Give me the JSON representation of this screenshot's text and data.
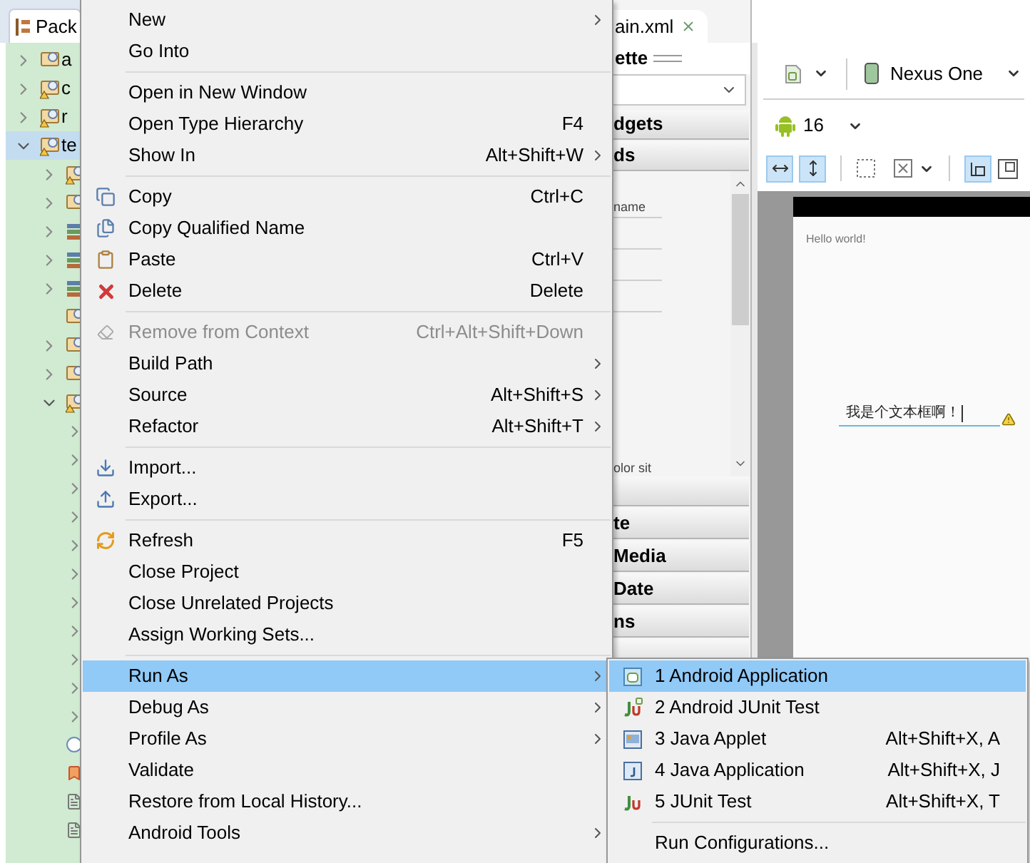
{
  "explorer": {
    "tab_label": "Pack",
    "items": [
      {
        "label": "a",
        "kind": "project",
        "expanded": false,
        "selected": false
      },
      {
        "label": "c",
        "kind": "project-warning",
        "expanded": false,
        "selected": false
      },
      {
        "label": "r",
        "kind": "project-warning",
        "expanded": false,
        "selected": false
      },
      {
        "label": "te",
        "kind": "project-warning",
        "expanded": true,
        "selected": true,
        "children": [
          {
            "kind": "package-warning",
            "expanded": false
          },
          {
            "kind": "package",
            "expanded": false
          },
          {
            "kind": "library",
            "expanded": false
          },
          {
            "kind": "library",
            "expanded": false
          },
          {
            "kind": "library",
            "expanded": false
          },
          {
            "kind": "package"
          },
          {
            "kind": "package",
            "expanded": false
          },
          {
            "kind": "package",
            "expanded": false
          },
          {
            "kind": "package-warning",
            "expanded": true,
            "children": [
              {
                "expanded": false
              },
              {
                "expanded": false
              },
              {
                "expanded": false
              },
              {
                "expanded": false
              },
              {
                "expanded": false
              },
              {
                "expanded": false
              },
              {
                "expanded": false
              },
              {
                "expanded": false
              },
              {
                "expanded": false
              },
              {
                "expanded": false
              },
              {
                "expanded": false
              }
            ]
          },
          {
            "kind": "class"
          },
          {
            "kind": "bookmark"
          },
          {
            "kind": "file"
          },
          {
            "kind": "file"
          }
        ]
      }
    ]
  },
  "palette": {
    "editor_tab": "ain.xml",
    "title": "ette",
    "sections_top": [
      {
        "label": "dgets"
      },
      {
        "label": "ds"
      }
    ],
    "list_items": [
      {
        "label": "name"
      },
      {
        "label": "olor sit"
      }
    ],
    "sections_bottom": [
      {
        "label": "te"
      },
      {
        "label": "Media"
      },
      {
        "label": "Date"
      },
      {
        "label": "ns"
      }
    ]
  },
  "editor": {
    "device": "Nexus One",
    "api_level": "16",
    "hello_text": "Hello world!",
    "edit_text": "我是个文本框啊！"
  },
  "menu": {
    "items": [
      {
        "kind": "plain",
        "label": "New",
        "submenu": true,
        "selected": false,
        "disabled": false
      },
      {
        "kind": "plain",
        "label": "Go Into",
        "submenu": false,
        "selected": false,
        "disabled": false
      },
      {
        "kind": "separator"
      },
      {
        "kind": "plain",
        "label": "Open in New Window",
        "submenu": false,
        "selected": false,
        "disabled": false
      },
      {
        "kind": "plain",
        "label": "Open Type Hierarchy",
        "shortcut": "F4",
        "submenu": false,
        "selected": false,
        "disabled": false
      },
      {
        "kind": "plain",
        "label": "Show In",
        "shortcut": "Alt+Shift+W",
        "submenu": true,
        "selected": false,
        "disabled": false
      },
      {
        "kind": "separator"
      },
      {
        "kind": "copy",
        "label": "Copy",
        "shortcut": "Ctrl+C",
        "submenu": false,
        "selected": false,
        "disabled": false
      },
      {
        "kind": "copyname",
        "label": "Copy Qualified Name",
        "submenu": false,
        "selected": false,
        "disabled": false
      },
      {
        "kind": "paste",
        "label": "Paste",
        "shortcut": "Ctrl+V",
        "submenu": false,
        "selected": false,
        "disabled": false
      },
      {
        "kind": "delete",
        "label": "Delete",
        "shortcut": "Delete",
        "submenu": false,
        "selected": false,
        "disabled": false
      },
      {
        "kind": "separator"
      },
      {
        "kind": "remove",
        "label": "Remove from Context",
        "shortcut": "Ctrl+Alt+Shift+Down",
        "submenu": false,
        "selected": false,
        "disabled": true
      },
      {
        "kind": "plain",
        "label": "Build Path",
        "submenu": true,
        "selected": false,
        "disabled": false
      },
      {
        "kind": "plain",
        "label": "Source",
        "shortcut": "Alt+Shift+S",
        "submenu": true,
        "selected": false,
        "disabled": false
      },
      {
        "kind": "plain",
        "label": "Refactor",
        "shortcut": "Alt+Shift+T",
        "submenu": true,
        "selected": false,
        "disabled": false
      },
      {
        "kind": "separator"
      },
      {
        "kind": "import",
        "label": "Import...",
        "submenu": false,
        "selected": false,
        "disabled": false
      },
      {
        "kind": "export",
        "label": "Export...",
        "submenu": false,
        "selected": false,
        "disabled": false
      },
      {
        "kind": "separator"
      },
      {
        "kind": "refresh",
        "label": "Refresh",
        "shortcut": "F5",
        "submenu": false,
        "selected": false,
        "disabled": false
      },
      {
        "kind": "plain",
        "label": "Close Project",
        "submenu": false,
        "selected": false,
        "disabled": false
      },
      {
        "kind": "plain",
        "label": "Close Unrelated Projects",
        "submenu": false,
        "selected": false,
        "disabled": false
      },
      {
        "kind": "plain",
        "label": "Assign Working Sets...",
        "submenu": false,
        "selected": false,
        "disabled": false
      },
      {
        "kind": "separator"
      },
      {
        "kind": "plain",
        "label": "Run As",
        "submenu": true,
        "selected": true,
        "disabled": false
      },
      {
        "kind": "plain",
        "label": "Debug As",
        "submenu": true,
        "selected": false,
        "disabled": false
      },
      {
        "kind": "plain",
        "label": "Profile As",
        "submenu": true,
        "selected": false,
        "disabled": false
      },
      {
        "kind": "plain",
        "label": "Validate",
        "submenu": false,
        "selected": false,
        "disabled": false
      },
      {
        "kind": "plain",
        "label": "Restore from Local History...",
        "submenu": false,
        "selected": false,
        "disabled": false
      },
      {
        "kind": "plain",
        "label": "Android Tools",
        "submenu": true,
        "selected": false,
        "disabled": false
      }
    ]
  },
  "submenu": {
    "items": [
      {
        "kind": "androidapp",
        "label": "1 Android Application",
        "selected": true
      },
      {
        "kind": "androidjunit",
        "label": "2 Android JUnit Test",
        "selected": false
      },
      {
        "kind": "applet",
        "label": "3 Java Applet",
        "shortcut": "Alt+Shift+X, A",
        "selected": false
      },
      {
        "kind": "javaapp",
        "label": "4 Java Application",
        "shortcut": "Alt+Shift+X, J",
        "selected": false
      },
      {
        "kind": "junit",
        "label": "5 JUnit Test",
        "shortcut": "Alt+Shift+X, T",
        "selected": false
      },
      {
        "kind": "separator"
      },
      {
        "kind": "plain",
        "label": "Run Configurations...",
        "selected": false
      }
    ]
  }
}
